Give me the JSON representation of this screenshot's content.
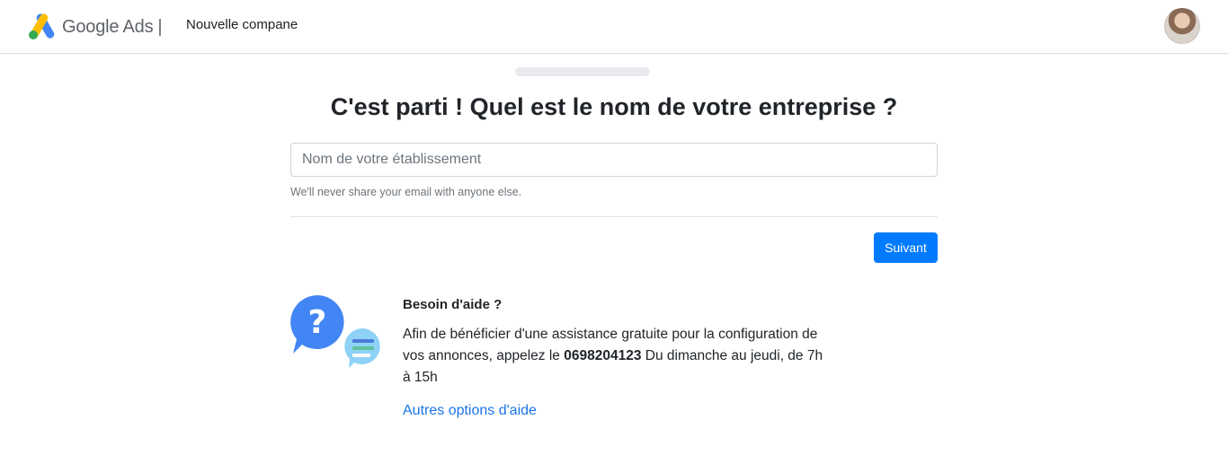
{
  "header": {
    "brand_name": "Google Ads",
    "separator": "|",
    "campaign_title": "Nouvelle compane",
    "logo_icon": "google-ads-logo-icon",
    "avatar_icon": "user-avatar"
  },
  "main": {
    "progress_fraction": 0,
    "heading": "C'est parti ! Quel est le nom de votre entreprise ?",
    "business_name": {
      "value": "",
      "placeholder": "Nom de votre établissement"
    },
    "help_text": "We'll never share your email with anyone else.",
    "next_label": "Suivant"
  },
  "help": {
    "icon": "help-question-chat-icon",
    "title": "Besoin d'aide ?",
    "body_before": "Afin de bénéficier d'une assistance gratuite pour la configuration de vos annonces, appelez le ",
    "phone": "0698204123",
    "body_after": " Du dimanche au jeudi, de 7h à 15h",
    "link_label": "Autres options d'aide"
  },
  "colors": {
    "primary_button": "#007bff",
    "link": "#1a73e8",
    "logo_blue": "#4285f4",
    "logo_yellow": "#fbbc04",
    "logo_green": "#34a853"
  }
}
